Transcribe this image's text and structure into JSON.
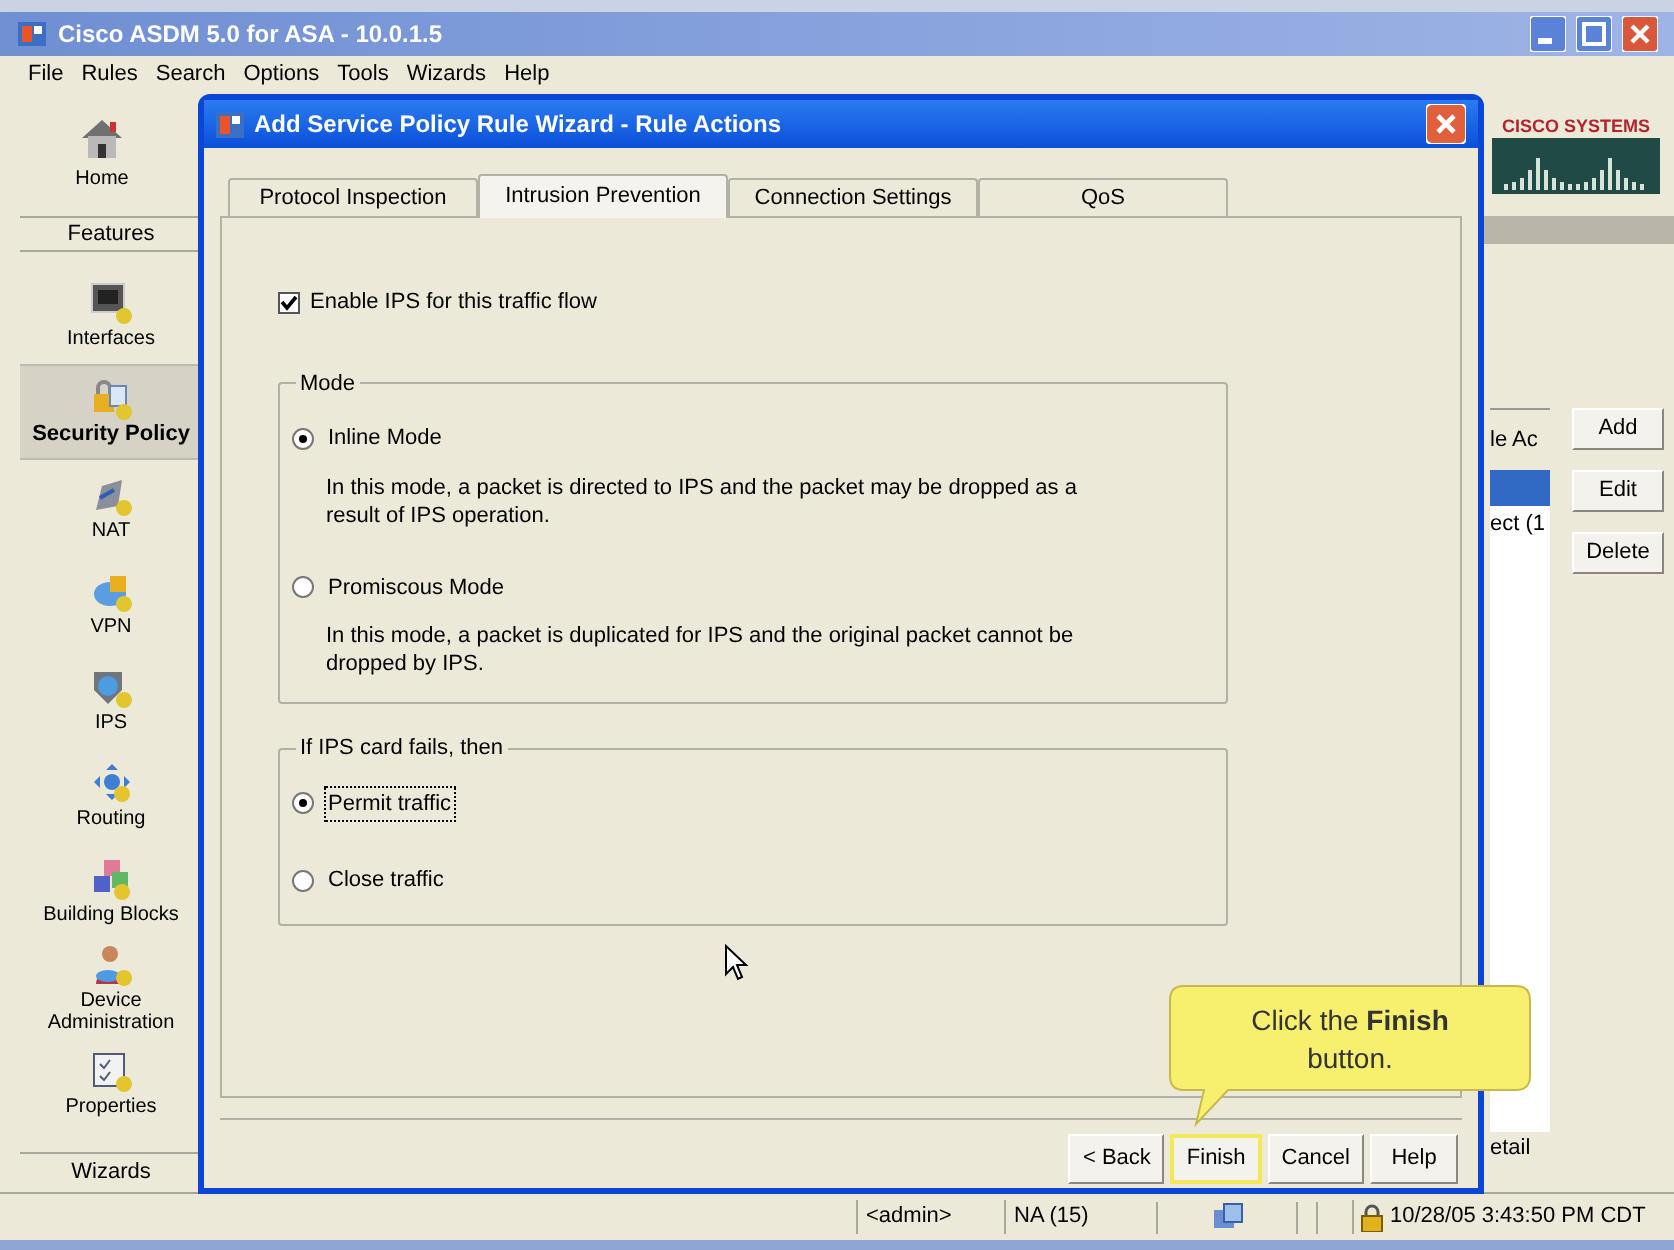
{
  "window": {
    "title": "Cisco ASDM 5.0 for ASA - 10.0.1.5"
  },
  "menu": [
    "File",
    "Rules",
    "Search",
    "Options",
    "Tools",
    "Wizards",
    "Help"
  ],
  "toolbar": {
    "home": "Home"
  },
  "logo": {
    "text": "CISCO SYSTEMS"
  },
  "sidebar": {
    "header": "Features",
    "items": [
      {
        "label": "Interfaces",
        "selected": false
      },
      {
        "label": "Security Policy",
        "selected": true
      },
      {
        "label": "NAT",
        "selected": false
      },
      {
        "label": "VPN",
        "selected": false
      },
      {
        "label": "IPS",
        "selected": false
      },
      {
        "label": "Routing",
        "selected": false
      },
      {
        "label": "Building Blocks",
        "selected": false
      },
      {
        "label": "Device Administration",
        "selected": false
      },
      {
        "label": "Properties",
        "selected": false
      }
    ],
    "footer": "Wizards"
  },
  "rule_table": {
    "header": "le Ac",
    "rows": [
      {
        "selected": true
      },
      {
        "text": "ect (1",
        "selected": false
      }
    ],
    "footer": "etail"
  },
  "side_buttons": [
    "Add",
    "Edit",
    "Delete"
  ],
  "dialog": {
    "title": "Add Service Policy Rule Wizard - Rule Actions",
    "tabs": [
      {
        "label": "Protocol Inspection",
        "selected": false
      },
      {
        "label": "Intrusion Prevention",
        "selected": true
      },
      {
        "label": "Connection Settings",
        "selected": false
      },
      {
        "label": "QoS",
        "selected": false
      }
    ],
    "enable_ips": {
      "label": "Enable IPS for this traffic flow",
      "checked": true
    },
    "mode_group": {
      "title": "Mode",
      "options": [
        {
          "label": "Inline Mode",
          "selected": true,
          "description": "In this mode, a packet is directed to IPS and the packet may be dropped as a result of IPS operation."
        },
        {
          "label": "Promiscous Mode",
          "selected": false,
          "description": "In this mode, a packet is duplicated for IPS and the original packet cannot be dropped by IPS."
        }
      ]
    },
    "fail_group": {
      "title": "If IPS card fails, then",
      "options": [
        {
          "label": "Permit traffic",
          "selected": true,
          "focused": true
        },
        {
          "label": "Close traffic",
          "selected": false,
          "focused": false
        }
      ]
    },
    "buttons": [
      {
        "label": "< Back",
        "highlighted": false
      },
      {
        "label": "Finish",
        "highlighted": true
      },
      {
        "label": "Cancel",
        "highlighted": false
      },
      {
        "label": "Help",
        "highlighted": false
      }
    ]
  },
  "callout": {
    "text": "Click the **Finish** button."
  },
  "status_bar": {
    "user": "<admin>",
    "privilege": "NA (15)",
    "time": "10/28/05 3:43:50 PM CDT"
  }
}
